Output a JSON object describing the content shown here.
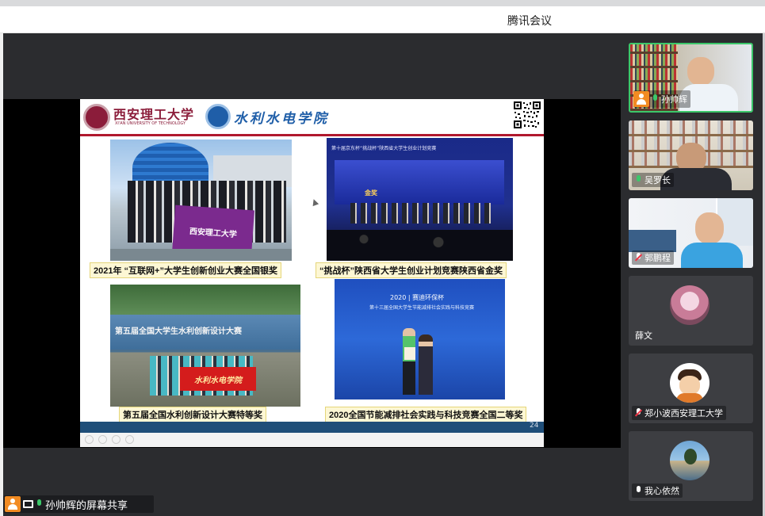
{
  "app": {
    "title": "腾讯会议"
  },
  "slide": {
    "school_cn": "西安理工大学",
    "school_en": "XI'AN UNIVERSITY OF TECHNOLOGY",
    "college": "水利水电学院",
    "page_number": "24",
    "captions": [
      "2021年 “互联网+”大学生创新创业大赛全国银奖",
      "“挑战杯”陕西省大学生创业计划竞赛陕西省金奖",
      "第五届全国水利创新设计大赛特等奖",
      "2020全国节能减排社会实践与科技竞赛全国二等奖"
    ],
    "photo_texts": {
      "banner_flag": "西安理工大学",
      "stage_title": "第十届京东杯“挑战杯”陕西省大学生创业计划竞赛",
      "stage_award": "金奖",
      "outdoor_banner": "第五届全国大学生水利创新设计大赛",
      "red_banner": "水利水电学院",
      "cert_title_1": "2020 | 赛迪环保杯",
      "cert_title_2": "第十三届全国大学生节能减排社会实践与科技竞赛"
    }
  },
  "participants": [
    {
      "name": "孙帅辉",
      "mic": "on",
      "host": true
    },
    {
      "name": "吴罗长",
      "mic": "on",
      "host": false
    },
    {
      "name": "郭鹏程",
      "mic": "muted",
      "host": false
    },
    {
      "name": "薛文",
      "mic": "none",
      "host": false
    },
    {
      "name": "郑小波西安理工大学",
      "mic": "muted",
      "host": false
    },
    {
      "name": "我心依然",
      "mic": "white",
      "host": false
    }
  ],
  "share_status": "孙帅辉的屏幕共享",
  "colors": {
    "accent_green": "#3cc76a",
    "host_orange": "#f28b22",
    "slide_red": "#b0182d",
    "slide_blue": "#1f4e79"
  }
}
